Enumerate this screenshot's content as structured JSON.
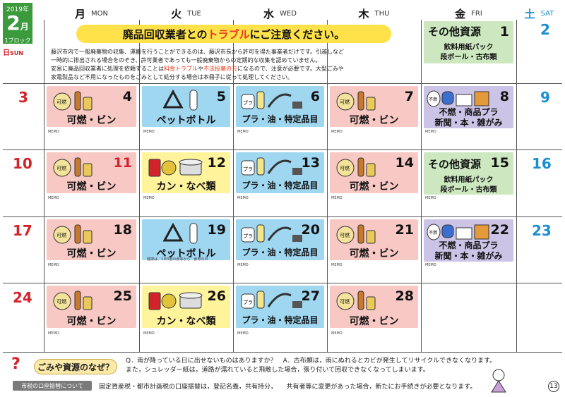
{
  "header": {
    "year": "2019年",
    "month": "2",
    "month_suffix": "月",
    "block": "1ブロック",
    "sun_kanji": "日",
    "sun_en": "SUN",
    "days": [
      {
        "k": "月",
        "e": "MON"
      },
      {
        "k": "火",
        "e": "TUE"
      },
      {
        "k": "水",
        "e": "WED"
      },
      {
        "k": "木",
        "e": "THU"
      },
      {
        "k": "金",
        "e": "FRI"
      },
      {
        "k": "土",
        "e": "SAT"
      }
    ]
  },
  "banner": {
    "pre": "廃品回収業者との",
    "hl": "トラブル",
    "post": "にご注意ください。"
  },
  "notice": {
    "line1": "藤沢市内で一般廃棄物の収集、運搬を行うことができるのは、藤沢市長から許可を得た事業者だけです。引越しなど",
    "line2": "一時的に排出される場合をのぞき、許可業者であっても一般廃棄物からの定期的な収集を認めていません。",
    "line3a": "安易に廃品回収業者に処理を依頼することは",
    "line3r1": "料金トラブル",
    "line3b": "や",
    "line3r2": "不法投棄の元",
    "line3c": "になるので、注意が必要です。大型ごみや",
    "line4": "家電製品など不用になったものをごみとして処分する場合は本冊子に従って処理してください。"
  },
  "labels": {
    "kanen": "可燃・ビン",
    "pet": "ペットボトル",
    "pura": "プラ・油・特定品目",
    "kan": "カン・なべ類",
    "funen1": "不燃・商品プラ",
    "funen2": "新聞・本・雑がみ",
    "other_title": "その他資源",
    "other_l1": "飲料用紙パック",
    "other_l2": "段ボール・古布類",
    "memo": "MEMO",
    "kanen_tag": "可燃",
    "funen_tag": "不燃"
  },
  "sundays": [
    "3",
    "10",
    "17",
    "24"
  ],
  "saturdays": [
    "2",
    "9",
    "16",
    "23"
  ],
  "weeks": [
    {
      "mon": "4",
      "tue": "5",
      "wed": "6",
      "thu": "7",
      "fri": "8"
    },
    {
      "mon": "11",
      "tue": "12",
      "wed": "13",
      "thu": "14",
      "fri": "15"
    },
    {
      "mon": "18",
      "tue": "19",
      "wed": "20",
      "thu": "21",
      "fri": "22"
    },
    {
      "mon": "25",
      "tue": "26",
      "wed": "27",
      "thu": "28"
    }
  ],
  "fri_week0": "1",
  "teeth_note": "健康は、1日3度の食事から　食育の日",
  "footer": {
    "q_title": "ごみや資源のなぜ？",
    "q_line1": "Q．雨が降っている日に出せないものはありますか？　A．古布類は，雨にぬれるとカビが発生してリサイクルできなくなります。",
    "q_line2": "また，シュレッダー紙は，道路が濡れていると飛散した場合，張り付いて回収できなくなってしまいます。",
    "tax_label": "市税の口座振替について",
    "tax_text": "固定資産税・都市計画税の口座振替は，登記名義，共有持分，　　共有者等に変更があった場合，新たにお手続きが必要となります。",
    "page": "13"
  },
  "colors": {
    "pink": "#f7c8c4",
    "blue": "#9fd6f0",
    "yellow": "#fff39c",
    "green": "#cde8c0",
    "purple": "#ccc4e6",
    "sun": "#d2232a",
    "sat": "#1a8fd0",
    "badge": "#3a9a3c"
  }
}
